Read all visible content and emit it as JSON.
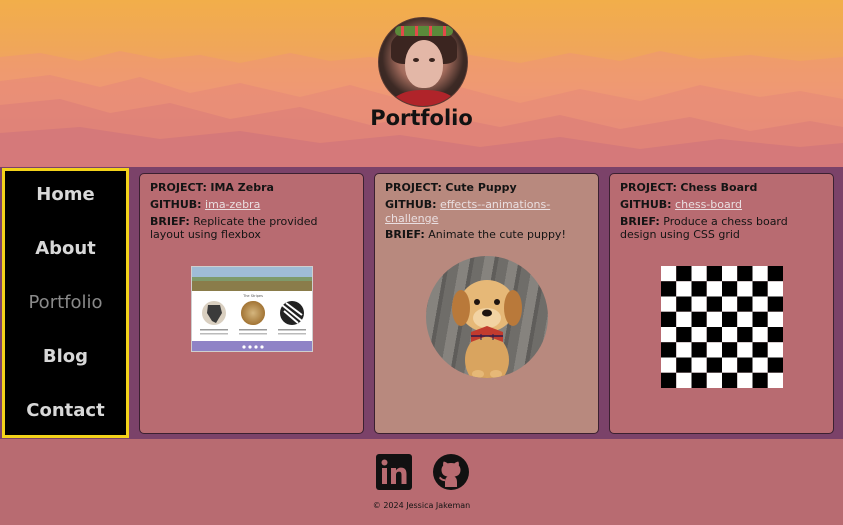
{
  "header": {
    "title": "Portfolio",
    "avatar_alt": "Profile photo"
  },
  "nav": {
    "items": [
      {
        "label": "Home"
      },
      {
        "label": "About"
      },
      {
        "label": "Portfolio"
      },
      {
        "label": "Blog"
      },
      {
        "label": "Contact"
      }
    ],
    "active": "Portfolio"
  },
  "projects": [
    {
      "project_label": "PROJECT:",
      "project_name": "IMA Zebra",
      "github_label": "GITHUB:",
      "github_link": "ima-zebra",
      "brief_label": "BRIEF:",
      "brief_text": "Replicate the provided layout using flexbox"
    },
    {
      "project_label": "PROJECT:",
      "project_name": "Cute Puppy",
      "github_label": "GITHUB:",
      "github_link": "effects--animations-challenge",
      "brief_label": "BRIEF:",
      "brief_text": "Animate the cute puppy!"
    },
    {
      "project_label": "PROJECT:",
      "project_name": "Chess Board",
      "github_label": "GITHUB:",
      "github_link": "chess-board",
      "brief_label": "BRIEF:",
      "brief_text": "Produce a chess board design using CSS grid"
    }
  ],
  "zebra_thumb": {
    "title": "The Stripes"
  },
  "footer": {
    "copyright": "© 2024 Jessica Jakeman",
    "icons": [
      "linkedin-icon",
      "github-icon"
    ]
  },
  "colors": {
    "page_bg": "#b86b71",
    "band_bg": "#7b4269",
    "nav_border": "#f3d21a",
    "nav_bg": "#000000",
    "card_alt_bg": "#b8897e"
  }
}
